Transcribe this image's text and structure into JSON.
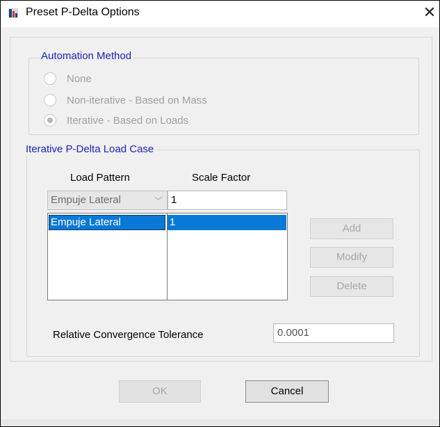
{
  "window": {
    "title": "Preset P-Delta Options",
    "close_glyph": "✕"
  },
  "automation": {
    "title": "Automation Method",
    "options": [
      {
        "label": "None",
        "checked": false
      },
      {
        "label": "Non-iterative - Based on Mass",
        "checked": false
      },
      {
        "label": "Iterative - Based on Loads",
        "checked": true
      }
    ]
  },
  "loadcase": {
    "title": "Iterative P-Delta Load Case",
    "col_pattern": "Load Pattern",
    "col_scale": "Scale Factor",
    "pattern_select_value": "Empuje Lateral",
    "combo_arrow": "﹀",
    "scale_input_value": "1",
    "rows": [
      {
        "pattern": "Empuje Lateral",
        "scale": "1"
      }
    ],
    "add_label": "Add",
    "modify_label": "Modify",
    "delete_label": "Delete"
  },
  "tolerance": {
    "label": "Relative Convergence Tolerance",
    "value": "0.0001"
  },
  "footer": {
    "ok_label": "OK",
    "cancel_label": "Cancel"
  },
  "icons": {
    "app": "app-icon",
    "close": "close-icon",
    "dropdown": "chevron-down-icon"
  },
  "colors": {
    "group_title": "#1a23b5",
    "selection": "#0a78d7"
  }
}
